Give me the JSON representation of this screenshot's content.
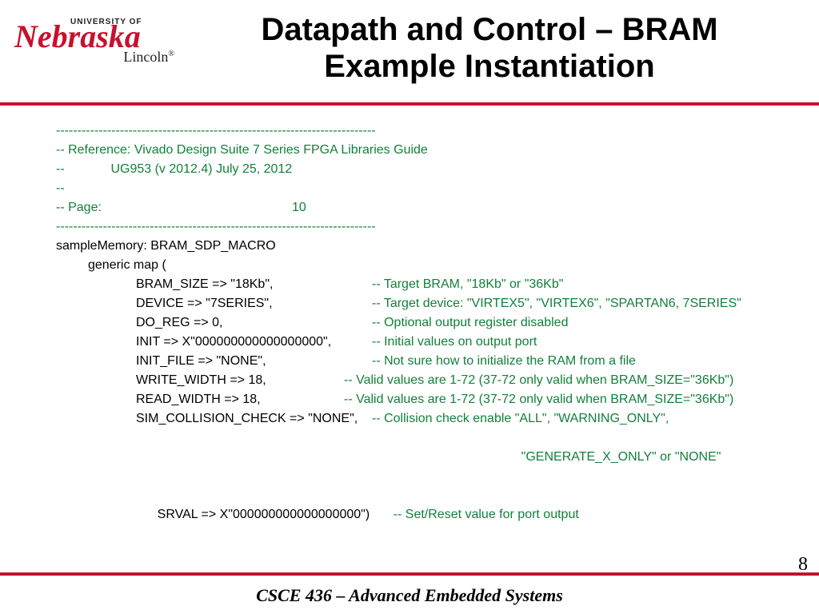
{
  "logo": {
    "univof": "UNIVERSITY OF",
    "nebraska": "Nebraska",
    "lincoln": "Lincoln"
  },
  "title_l1": "Datapath and Control – BRAM",
  "title_l2": "Example Instantiation",
  "dashes": "---------------------------------------------------------------------------",
  "ref_line": "-- Reference: Vivado Design Suite 7 Series FPGA Libraries Guide",
  "ug_line_a": "--             UG953 (v 2012.4) July 25, 2012",
  "blank_cmt": "--",
  "page_label": "-- Page:",
  "page_val": "10",
  "sample": "sampleMemory: BRAM_SDP_MACRO",
  "generic": "generic map (",
  "rows": [
    {
      "code": "BRAM_SIZE => \"18Kb\",",
      "w": "a",
      "cmt": "-- Target BRAM, \"18Kb\" or \"36Kb\""
    },
    {
      "code": "DEVICE => \"7SERIES\",",
      "w": "a",
      "cmt": "-- Target device: \"VIRTEX5\", \"VIRTEX6\", \"SPARTAN6, 7SERIES\""
    },
    {
      "code": "DO_REG => 0,",
      "w": "a",
      "cmt": "-- Optional output register disabled"
    },
    {
      "code": "INIT => X\"000000000000000000\",",
      "w": "a",
      "cmt": "-- Initial values on output port"
    },
    {
      "code": "INIT_FILE => \"NONE\",",
      "w": "a",
      "cmt": "-- Not sure how to initialize the RAM from a file"
    },
    {
      "code": "WRITE_WIDTH => 18,",
      "w": "b",
      "cmt": "-- Valid values are 1-72 (37-72 only valid when BRAM_SIZE=\"36Kb\")"
    },
    {
      "code": "READ_WIDTH => 18,",
      "w": "b",
      "cmt": "-- Valid values are 1-72 (37-72 only valid when BRAM_SIZE=\"36Kb\")"
    },
    {
      "code": "SIM_COLLISION_CHECK => \"NONE\",",
      "w": "a",
      "cmt": "-- Collision check enable \"ALL\", \"WARNING_ONLY\","
    }
  ],
  "sim_line2": "\"GENERATE_X_ONLY\" or \"NONE\"",
  "srval_code": "SRVAL => X\"000000000000000000\")",
  "srval_cmt": "-- Set/Reset value for port output",
  "footer": "CSCE 436 – Advanced Embedded Systems",
  "pagenum": "8"
}
